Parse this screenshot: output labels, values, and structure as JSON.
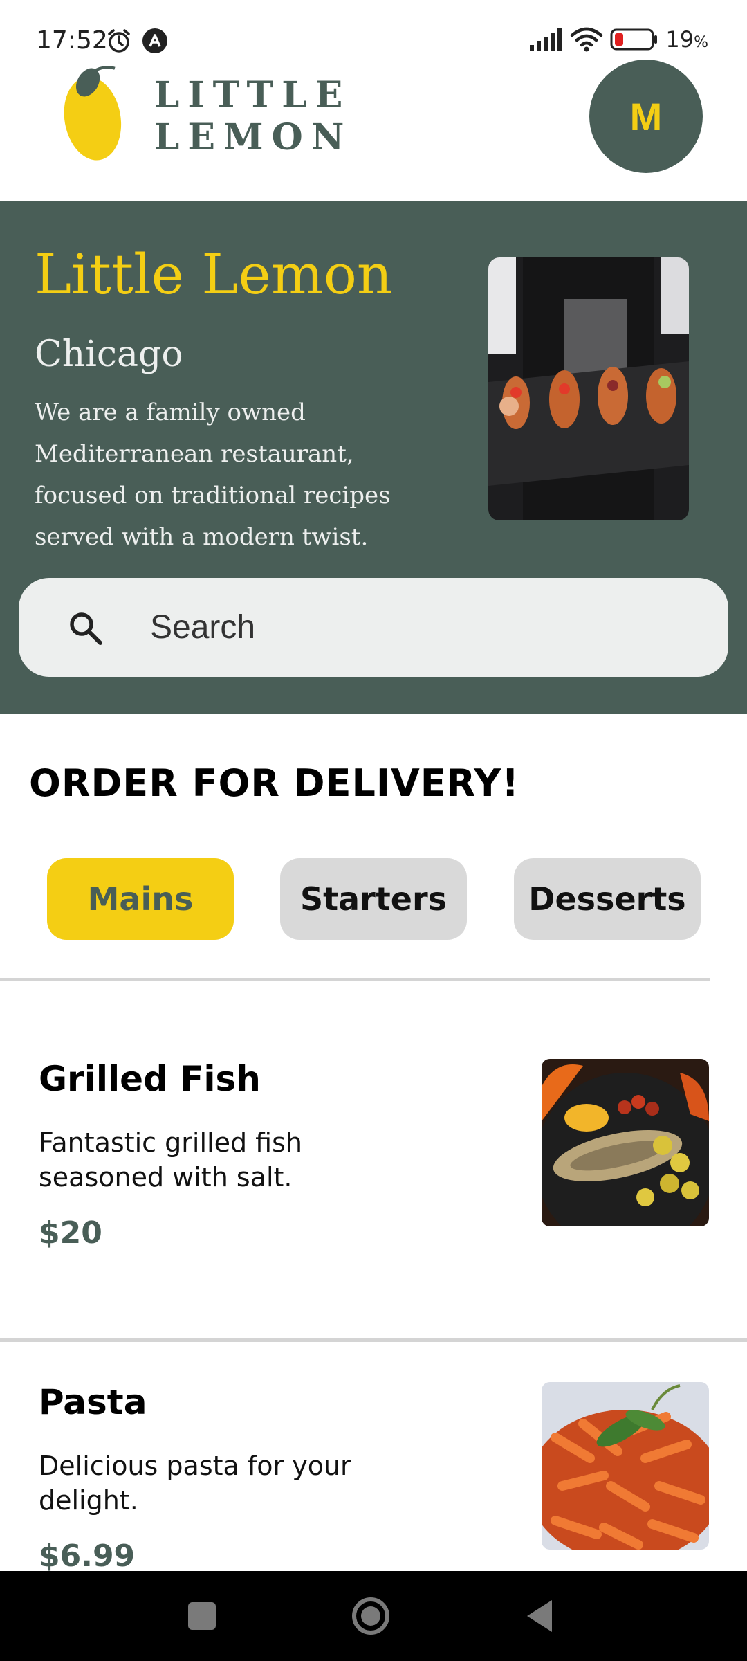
{
  "status_bar": {
    "time": "17:52",
    "battery_percent": "19",
    "battery_unit": "%"
  },
  "header": {
    "logo_text": "LITTLE LEMON",
    "avatar_initial": "M"
  },
  "hero": {
    "title": "Little Lemon",
    "city": "Chicago",
    "description": "We are a family owned Mediterranean restaurant, focused on traditional recipes served with a modern twist.",
    "search_placeholder": "Search"
  },
  "order": {
    "title": "ORDER FOR DELIVERY!",
    "categories": [
      {
        "label": "Mains",
        "selected": true
      },
      {
        "label": "Starters",
        "selected": false
      },
      {
        "label": "Desserts",
        "selected": false
      }
    ]
  },
  "menu_items": [
    {
      "name": "Grilled Fish",
      "description": "Fantastic grilled fish seasoned with salt.",
      "price": "$20"
    },
    {
      "name": "Pasta",
      "description": "Delicious pasta for your delight.",
      "price": "$6.99"
    }
  ],
  "colors": {
    "primary_green": "#495E57",
    "primary_yellow": "#F4CE14",
    "light_gray": "#EDEFEE"
  },
  "icons": [
    "alarm-icon",
    "notification-icon",
    "signal-icon",
    "wifi-icon",
    "battery-icon",
    "search-icon",
    "recent-apps-icon",
    "home-icon",
    "back-icon"
  ]
}
